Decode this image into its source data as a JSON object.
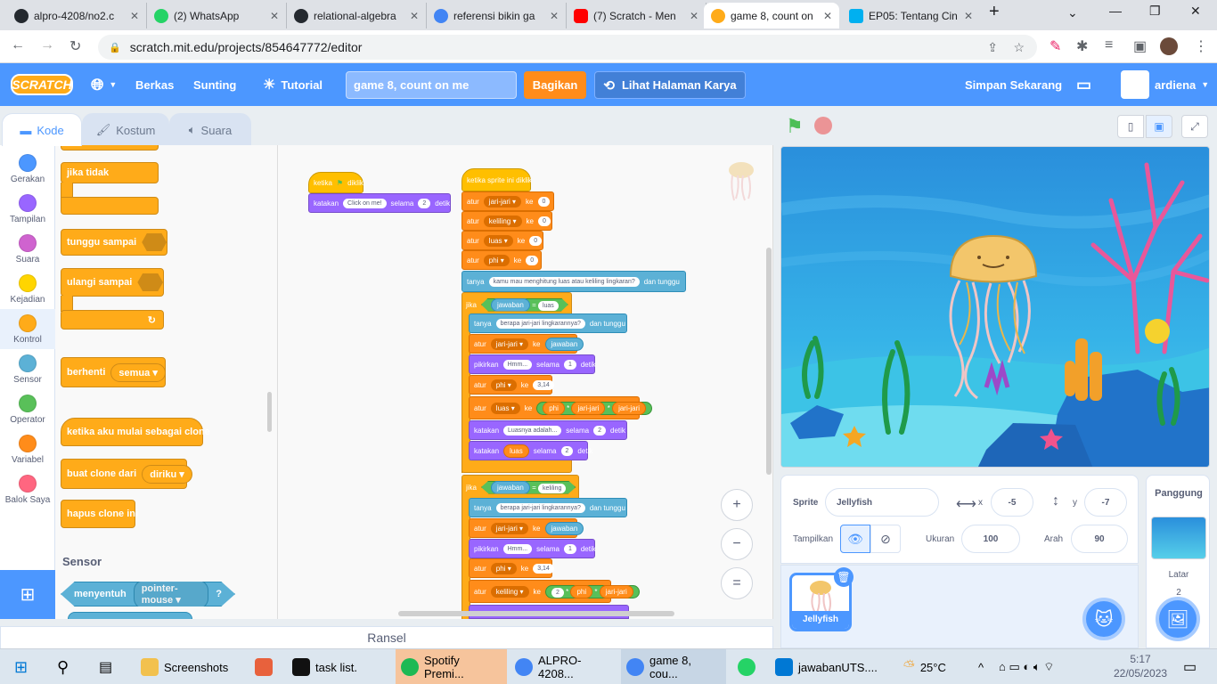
{
  "browser": {
    "tabs": [
      {
        "label": "alpro-4208/no2.c",
        "icon_color": "#24292f"
      },
      {
        "label": "(2) WhatsApp",
        "icon_color": "#25d366"
      },
      {
        "label": "relational-algebra",
        "icon_color": "#24292f"
      },
      {
        "label": "referensi bikin ga",
        "icon_color": "#4285f4"
      },
      {
        "label": "(7) Scratch - Men",
        "icon_color": "#ff0000"
      },
      {
        "label": "game 8, count on",
        "icon_color": "#ffab19"
      },
      {
        "label": "EP05: Tentang Cin",
        "icon_color": "#00b0f0"
      }
    ],
    "new_tab": "+",
    "url": "scratch.mit.edu/projects/854647772/editor"
  },
  "menubar": {
    "logo": "SCRATCH",
    "file": "Berkas",
    "edit": "Sunting",
    "tutorial": "Tutorial",
    "project_title": "game 8, count on me",
    "share": "Bagikan",
    "see_project": "Lihat Halaman Karya",
    "save_now": "Simpan Sekarang",
    "username": "ardiena"
  },
  "editor_tabs": {
    "code": "Kode",
    "costume": "Kostum",
    "sound": "Suara"
  },
  "categories": [
    {
      "label": "Gerakan",
      "color": "#4c97ff"
    },
    {
      "label": "Tampilan",
      "color": "#9966ff"
    },
    {
      "label": "Suara",
      "color": "#cf63cf"
    },
    {
      "label": "Kejadian",
      "color": "#ffd500"
    },
    {
      "label": "Kontrol",
      "color": "#ffab19"
    },
    {
      "label": "Sensor",
      "color": "#5cb1d6"
    },
    {
      "label": "Operator",
      "color": "#59c059"
    },
    {
      "label": "Variabel",
      "color": "#ff8c1a"
    },
    {
      "label": "Balok Saya",
      "color": "#ff6680"
    }
  ],
  "palette": {
    "if_else": "jika tidak",
    "wait_until": "tunggu sampai",
    "repeat_until": "ulangi sampai",
    "stop": "berhenti",
    "stop_option": "semua",
    "when_clone": "ketika aku mulai sebagai clone",
    "create_clone": "buat clone dari",
    "create_clone_option": "diriku",
    "delete_clone": "hapus clone ini",
    "sensor_header": "Sensor",
    "touching": "menyentuh",
    "touching_option": "pointer-mouse",
    "touching_q": "?"
  },
  "script1": {
    "hat": "ketika",
    "hat2": "diklik",
    "say": "katakan",
    "say_text": "Click on me!",
    "for": "selama",
    "secs": "2",
    "secs_label": "detik"
  },
  "script2": {
    "hat": "ketika sprite ini diklik",
    "set": "atur",
    "to": "ke",
    "v_radius": "jari-jari",
    "v_perim": "keliling",
    "v_area": "luas",
    "v_pi": "phi",
    "zero": "0",
    "ask": "tanya",
    "ask_text": "kamu mau menghitung luas atau keliling lingkaran?",
    "and_wait": "dan tunggu",
    "if": "jika",
    "answer": "jawaban",
    "eq": "=",
    "ask2_text": "berapa jari-jari lingkarannya?",
    "think": "pikirkan",
    "hmm": "Hmm...",
    "one": "1",
    "detik": "detik",
    "pi_val": "3,14",
    "times": "*",
    "say": "katakan",
    "area_text": "Luasnya adalah...",
    "two": "2",
    "for": "selama"
  },
  "zoom": {
    "in": "+",
    "out": "−",
    "reset": "="
  },
  "backpack": "Ransel",
  "sprite_info": {
    "sprite_label": "Sprite",
    "sprite_name": "Jellyfish",
    "x_label": "x",
    "x": "-5",
    "y_label": "y",
    "y": "-7",
    "show_label": "Tampilkan",
    "size_label": "Ukuran",
    "size": "100",
    "direction_label": "Arah",
    "direction": "90"
  },
  "sprite_list": [
    {
      "name": "Jellyfish"
    }
  ],
  "stage_panel": {
    "title": "Panggung",
    "backdrops_label": "Latar",
    "backdrops_count": "2"
  },
  "taskbar": {
    "items": [
      {
        "label": "Screenshots",
        "color": "#f2c14e"
      },
      {
        "label": "",
        "color": "#e8613c"
      },
      {
        "label": "task list.",
        "color": "#111"
      },
      {
        "label": "Spotify Premi...",
        "color": "#1db954"
      },
      {
        "label": "ALPRO-4208...",
        "color": "#4285f4"
      },
      {
        "label": "game 8, cou...",
        "color": "#4285f4"
      },
      {
        "label": "",
        "color": "#25d366"
      },
      {
        "label": "jawabanUTS....",
        "color": "#0078d4"
      }
    ],
    "weather": "25°C",
    "time": "5:17",
    "date": "22/05/2023"
  }
}
